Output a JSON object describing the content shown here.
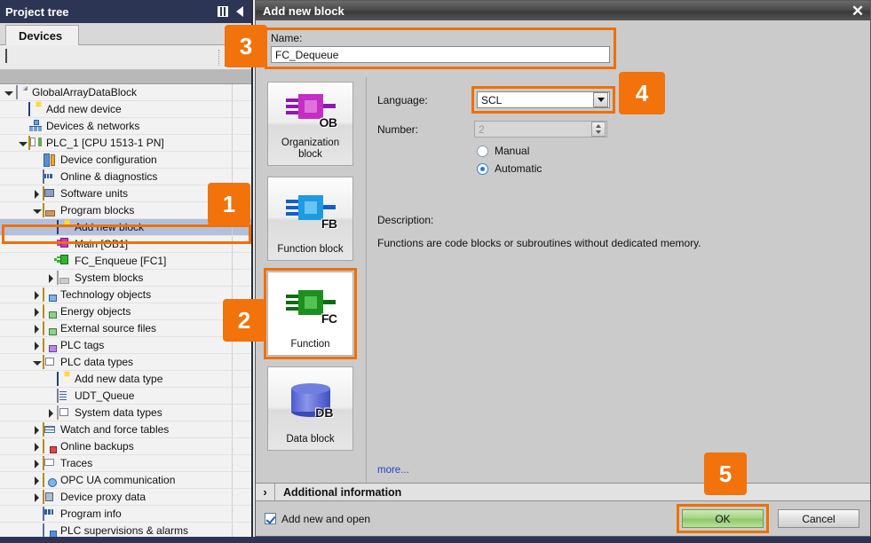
{
  "project_tree": {
    "header_title": "Project tree",
    "header_icons": [
      "columns-icon",
      "collapse-left-icon"
    ],
    "tab_label": "Devices",
    "toolbar": {
      "left_icon": "tree-settings-icon",
      "right_icon": "grid-view-icon"
    },
    "items": [
      {
        "label": "GlobalArrayDataBlock",
        "indent": 0,
        "toggle": "down",
        "icon": "project-page-icon"
      },
      {
        "label": "Add new device",
        "indent": 1,
        "toggle": "none",
        "icon": "add-new-device-icon"
      },
      {
        "label": "Devices & networks",
        "indent": 1,
        "toggle": "none",
        "icon": "devices-networks-icon"
      },
      {
        "label": "PLC_1 [CPU 1513-1 PN]",
        "indent": 1,
        "toggle": "down",
        "icon": "plc-device-icon"
      },
      {
        "label": "Device configuration",
        "indent": 2,
        "toggle": "none",
        "icon": "device-configuration-icon"
      },
      {
        "label": "Online & diagnostics",
        "indent": 2,
        "toggle": "none",
        "icon": "online-diagnostics-icon"
      },
      {
        "label": "Software units",
        "indent": 2,
        "toggle": "right",
        "icon": "software-units-folder-icon"
      },
      {
        "label": "Program blocks",
        "indent": 2,
        "toggle": "down",
        "icon": "program-blocks-folder-icon"
      },
      {
        "label": "Add new block",
        "indent": 3,
        "toggle": "none",
        "icon": "add-new-block-icon",
        "selected": true
      },
      {
        "label": "Main [OB1]",
        "indent": 3,
        "toggle": "none",
        "icon": "ob-block-icon"
      },
      {
        "label": "FC_Enqueue [FC1]",
        "indent": 3,
        "toggle": "none",
        "icon": "fc-block-icon"
      },
      {
        "label": "System blocks",
        "indent": 3,
        "toggle": "right",
        "icon": "system-blocks-folder-icon"
      },
      {
        "label": "Technology objects",
        "indent": 2,
        "toggle": "right",
        "icon": "technology-objects-folder-icon"
      },
      {
        "label": "Energy objects",
        "indent": 2,
        "toggle": "right",
        "icon": "energy-objects-folder-icon"
      },
      {
        "label": "External source files",
        "indent": 2,
        "toggle": "right",
        "icon": "external-source-files-folder-icon"
      },
      {
        "label": "PLC tags",
        "indent": 2,
        "toggle": "right",
        "icon": "plc-tags-folder-icon"
      },
      {
        "label": "PLC data types",
        "indent": 2,
        "toggle": "down",
        "icon": "plc-data-types-folder-icon"
      },
      {
        "label": "Add new data type",
        "indent": 3,
        "toggle": "none",
        "icon": "add-new-data-type-icon"
      },
      {
        "label": "UDT_Queue",
        "indent": 3,
        "toggle": "none",
        "icon": "udt-icon"
      },
      {
        "label": "System data types",
        "indent": 3,
        "toggle": "right",
        "icon": "system-data-types-folder-icon"
      },
      {
        "label": "Watch and force tables",
        "indent": 2,
        "toggle": "right",
        "icon": "watch-force-tables-icon"
      },
      {
        "label": "Online backups",
        "indent": 2,
        "toggle": "right",
        "icon": "online-backups-icon"
      },
      {
        "label": "Traces",
        "indent": 2,
        "toggle": "right",
        "icon": "traces-icon"
      },
      {
        "label": "OPC UA communication",
        "indent": 2,
        "toggle": "right",
        "icon": "opc-ua-icon"
      },
      {
        "label": "Device proxy data",
        "indent": 2,
        "toggle": "right",
        "icon": "device-proxy-data-icon"
      },
      {
        "label": "Program info",
        "indent": 2,
        "toggle": "none",
        "icon": "program-info-icon"
      },
      {
        "label": "PLC supervisions & alarms",
        "indent": 2,
        "toggle": "none",
        "icon": "plc-supervisions-alarms-icon"
      }
    ]
  },
  "dialog": {
    "title": "Add new block",
    "close_icon": "✕",
    "name_label": "Name:",
    "name_value": "FC_Dequeue",
    "block_types": [
      {
        "label_line1": "Organization",
        "label_line2": "block",
        "tag": "OB",
        "kind": "ob",
        "selected": false
      },
      {
        "label_line1": "Function block",
        "label_line2": "",
        "tag": "FB",
        "kind": "fb",
        "selected": false
      },
      {
        "label_line1": "Function",
        "label_line2": "",
        "tag": "FC",
        "kind": "fc",
        "selected": true
      },
      {
        "label_line1": "Data block",
        "label_line2": "",
        "tag": "DB",
        "kind": "db",
        "selected": false
      }
    ],
    "language_label": "Language:",
    "language_value": "SCL",
    "number_label": "Number:",
    "number_value": "2",
    "radio_manual": "Manual",
    "radio_automatic": "Automatic",
    "radio_selected": "Automatic",
    "description_label": "Description:",
    "description_text": "Functions are code blocks or subroutines without dedicated memory.",
    "more_link": "more...",
    "additional_information": "Additional information",
    "additional_chevron": "›",
    "checkbox_label": "Add new and open",
    "checkbox_checked": true,
    "ok_label": "OK",
    "cancel_label": "Cancel"
  },
  "badges": {
    "b1": "1",
    "b2": "2",
    "b3": "3",
    "b4": "4",
    "b5": "5"
  },
  "colors": {
    "accent_orange": "#f2720c",
    "highlight_orange": "#ef7000",
    "titlebar_navy": "#2c3553",
    "dialog_gray": "#cbcbcb",
    "selection_blue": "#b3c0dc",
    "ok_green": "#8fc76a",
    "link_blue": "#2a3fd0"
  }
}
